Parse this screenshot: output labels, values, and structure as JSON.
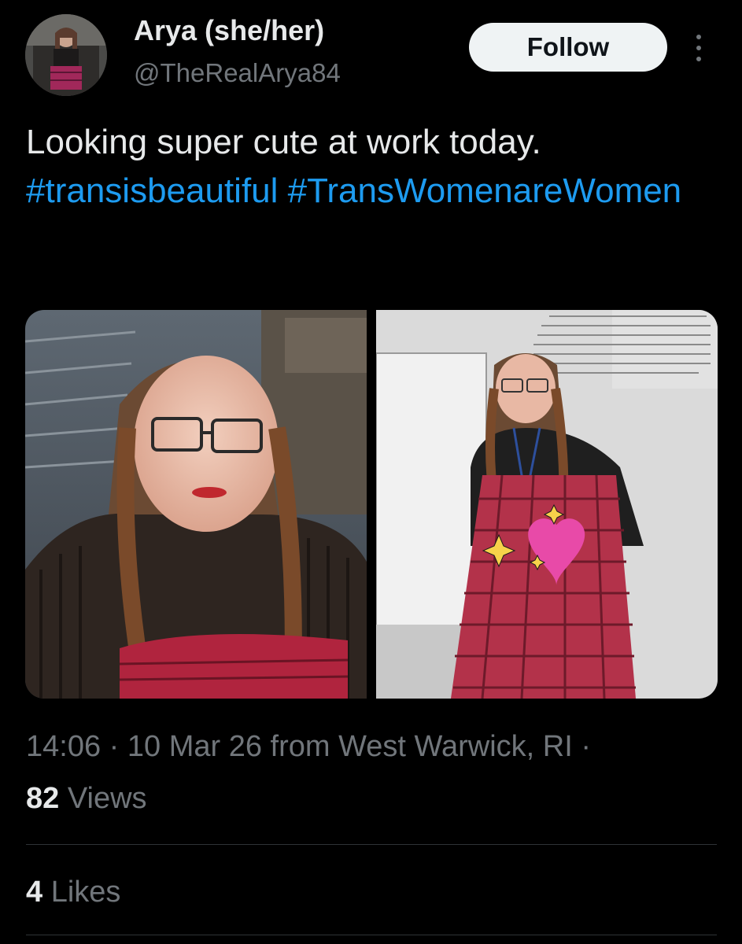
{
  "user": {
    "display_name": "Arya (she/her)",
    "handle": "@TheRealArya84",
    "avatar_icon": "profile-photo"
  },
  "header": {
    "follow_label": "Follow",
    "more_icon": "more-vertical-icon"
  },
  "tweet": {
    "text_plain": "Looking super cute at work today. ",
    "hashtags": [
      "#transisbeautiful",
      "#TransWomenareWomen"
    ]
  },
  "media": {
    "photo_count": 2,
    "sticker_icon": "sparkling-heart-icon"
  },
  "meta": {
    "time": "14:06",
    "sep": "·",
    "date": "10 Mar 26",
    "location_text": "from West Warwick, RI",
    "trailing_sep": "·"
  },
  "stats": {
    "views_count": "82",
    "views_label": "Views",
    "likes_count": "4",
    "likes_label": "Likes"
  },
  "colors": {
    "background": "#000000",
    "text_primary": "#e7e9ea",
    "text_secondary": "#71767b",
    "link": "#1d9bf0",
    "follow_bg": "#eff3f4",
    "divider": "#2f3336"
  }
}
